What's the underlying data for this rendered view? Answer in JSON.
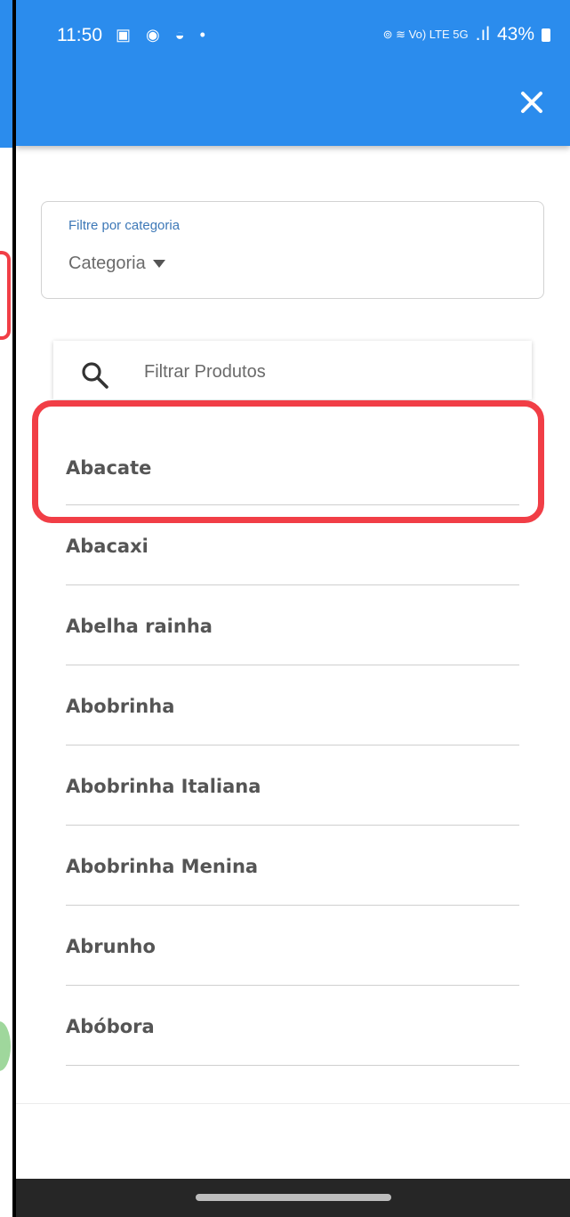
{
  "status_bar": {
    "time": "11:50",
    "left_icons": "▣ ◉ ◒ •",
    "network": "⊚ ≋ Vo) LTE 5G",
    "signal": ".ıl",
    "battery": "43%"
  },
  "filter": {
    "label": "Filtre por categoria",
    "value": "Categoria"
  },
  "search": {
    "placeholder": "Filtrar Produtos"
  },
  "products": [
    "Abacate",
    "Abacaxi",
    "Abelha rainha",
    "Abobrinha",
    "Abobrinha Italiana",
    "Abobrinha Menina",
    "Abrunho",
    "Abóbora"
  ],
  "colors": {
    "app_bar": "#2b8ced",
    "highlight": "#f13e46",
    "label": "#3d78b7"
  },
  "icons": {
    "close": "close-icon",
    "search": "search-icon",
    "dropdown": "caret-down-icon"
  }
}
